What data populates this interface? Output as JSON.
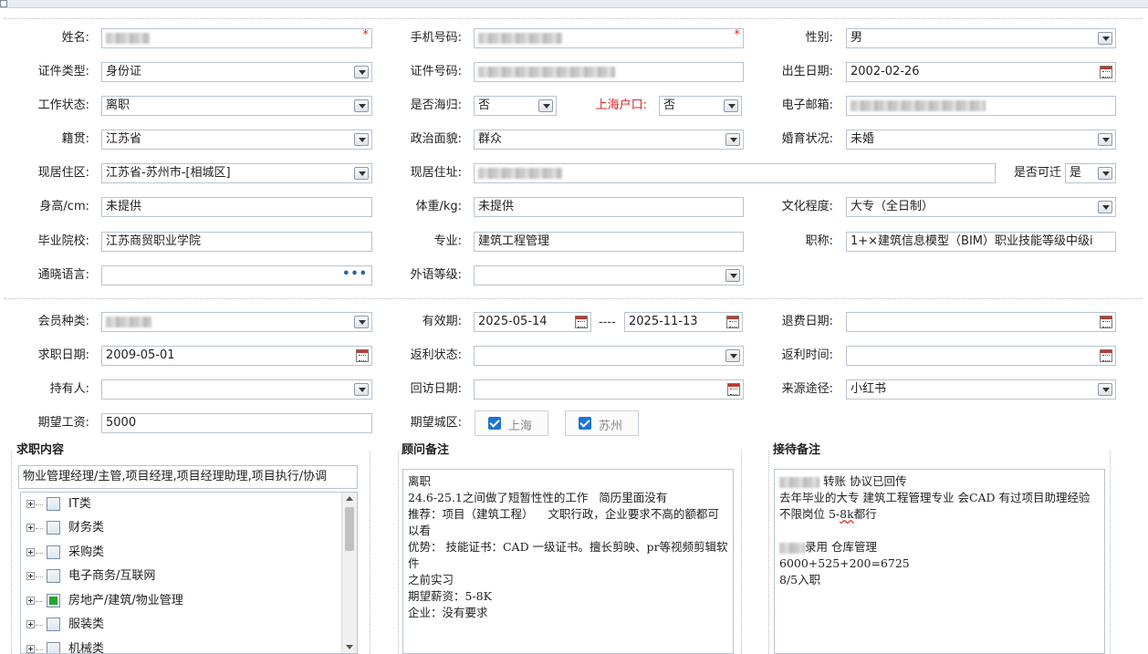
{
  "labels": {
    "name": "姓名:",
    "phone": "手机号码:",
    "gender": "性别:",
    "id_type": "证件类型:",
    "id_no": "证件号码:",
    "birth": "出生日期:",
    "work_status": "工作状态:",
    "returnee": "是否海归:",
    "sh_hukou": "上海户口:",
    "email": "电子邮箱:",
    "native": "籍贯:",
    "politics": "政治面貌:",
    "marital": "婚育状况:",
    "residence_area": "现居住区:",
    "residence_addr": "现居住址:",
    "relocate": "是否可迁",
    "height": "身高/cm:",
    "weight": "体重/kg:",
    "education": "文化程度:",
    "school": "毕业院校:",
    "major": "专业:",
    "title": "职称:",
    "language": "通晓语言:",
    "foreign_level": "外语等级:",
    "member_type": "会员种类:",
    "validity": "有效期:",
    "refund_date": "退费日期:",
    "job_date": "求职日期:",
    "rebate_status": "返利状态:",
    "rebate_time": "返利时间:",
    "holder": "持有人:",
    "revisit_date": "回访日期:",
    "source": "来源途径:",
    "salary": "期望工资:",
    "city": "期望城区:"
  },
  "values": {
    "gender": "男",
    "id_type": "身份证",
    "birth": "2002-02-26",
    "work_status": "离职",
    "returnee": "否",
    "sh_hukou": "否",
    "native": "江苏省",
    "politics": "群众",
    "marital": "未婚",
    "residence_area": "江苏省-苏州市-[相城区]",
    "relocate": "是",
    "height": "未提供",
    "weight": "未提供",
    "education": "大专（全日制）",
    "school": "江苏商贸职业学院",
    "major": "建筑工程管理",
    "title": "1+×建筑信息模型（BIM）职业技能等级中级i",
    "language": "",
    "foreign_level": "",
    "validity_start": "2025-05-14",
    "validity_sep": "----",
    "validity_end": "2025-11-13",
    "refund_date": "",
    "job_date": "2009-05-01",
    "rebate_status": "",
    "rebate_time": "",
    "holder": "",
    "revisit_date": "",
    "source": "小红书",
    "salary": "5000",
    "required_mark": "*"
  },
  "cities": [
    {
      "label": "上海",
      "checked": true
    },
    {
      "label": "苏州",
      "checked": true
    }
  ],
  "job_section": {
    "title": "求职内容",
    "summary": "物业管理经理/主管,项目经理,项目经理助理,项目执行/协调",
    "tree": [
      {
        "label": "IT类",
        "checked": false
      },
      {
        "label": "财务类",
        "checked": false
      },
      {
        "label": "采购类",
        "checked": false
      },
      {
        "label": "电子商务/互联网",
        "checked": false
      },
      {
        "label": "房地产/建筑/物业管理",
        "checked": true
      },
      {
        "label": "服装类",
        "checked": false
      },
      {
        "label": "机械类",
        "checked": false
      }
    ]
  },
  "consultant_section": {
    "title": "顾问备注",
    "text": "离职\n24.6-25.1之间做了短暂性性的工作   简历里面没有\n推荐：项目（建筑工程）    文职行政，企业要求不高的额都可以看\n优势： 技能证书：CAD 一级证书。擅长剪映、pr等视频剪辑软件\n之前实习\n期望薪资：5-8K\n企业：没有要求"
  },
  "reception_section": {
    "title": "接待备注",
    "line1": "转账 协议已回传",
    "line2a": "去年毕业的大专  建筑工程管理专业  会CAD 有过项目助理经验   不限岗位  5-",
    "line2b": "8k",
    "line2c": "都行",
    "line3": "录用 仓库管理",
    "line4": "6000+525+200=6725",
    "line5": "8/5入职"
  },
  "icons": [
    "dropdown-arrow-icon",
    "calendar-icon",
    "more-dots-icon",
    "checkbox-checked-icon",
    "tree-expand-icon"
  ]
}
